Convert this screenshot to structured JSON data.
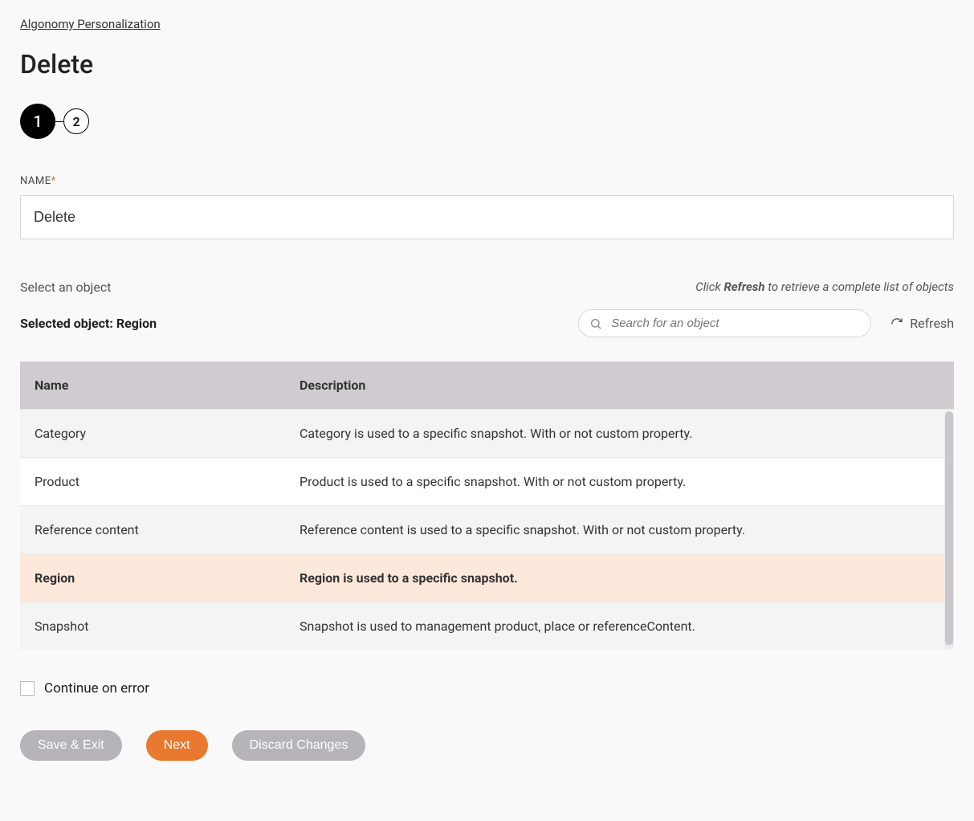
{
  "breadcrumb": {
    "label": "Algonomy Personalization"
  },
  "page": {
    "title": "Delete"
  },
  "stepper": {
    "steps": [
      "1",
      "2"
    ],
    "active_index": 0
  },
  "name_field": {
    "label": "NAME",
    "required_marker": "*",
    "value": "Delete"
  },
  "object_section": {
    "select_label": "Select an object",
    "refresh_hint_pre": "Click ",
    "refresh_hint_bold": "Refresh",
    "refresh_hint_post": " to retrieve a complete list of objects",
    "selected_label_prefix": "Selected object: ",
    "selected_value": "Region",
    "search_placeholder": "Search for an object",
    "refresh_label": "Refresh"
  },
  "table": {
    "headers": {
      "name": "Name",
      "description": "Description"
    },
    "rows": [
      {
        "name": "Category",
        "description": "Category is used to a specific snapshot. With or not custom property.",
        "selected": false
      },
      {
        "name": "Product",
        "description": "Product is used to a specific snapshot. With or not custom property.",
        "selected": false
      },
      {
        "name": "Reference content",
        "description": "Reference content is used to a specific snapshot. With or not custom property.",
        "selected": false
      },
      {
        "name": "Region",
        "description": "Region is used to a specific snapshot.",
        "selected": true
      },
      {
        "name": "Snapshot",
        "description": "Snapshot is used to management product, place or referenceContent.",
        "selected": false
      }
    ]
  },
  "continue_on_error": {
    "label": "Continue on error",
    "checked": false
  },
  "buttons": {
    "save_exit": "Save & Exit",
    "next": "Next",
    "discard": "Discard Changes"
  },
  "colors": {
    "accent": "#e8792f",
    "step_active_bg": "#000000",
    "table_header_bg": "#cfcbd0",
    "row_selected_bg": "#fce9db"
  }
}
